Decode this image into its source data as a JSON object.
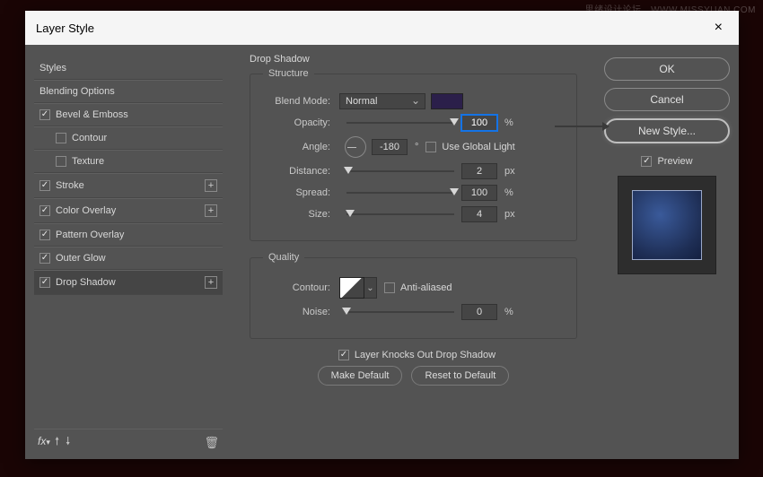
{
  "dialog": {
    "title": "Layer Style"
  },
  "watermark": "思绪设计论坛　WWW.MISSYUAN.COM",
  "sidebar": {
    "items": [
      {
        "label": "Styles",
        "checked": null,
        "plus": false,
        "sub": false
      },
      {
        "label": "Blending Options",
        "checked": null,
        "plus": false,
        "sub": false
      },
      {
        "label": "Bevel & Emboss",
        "checked": true,
        "plus": false,
        "sub": false
      },
      {
        "label": "Contour",
        "checked": false,
        "plus": false,
        "sub": true
      },
      {
        "label": "Texture",
        "checked": false,
        "plus": false,
        "sub": true
      },
      {
        "label": "Stroke",
        "checked": true,
        "plus": true,
        "sub": false
      },
      {
        "label": "Color Overlay",
        "checked": true,
        "plus": true,
        "sub": false
      },
      {
        "label": "Pattern Overlay",
        "checked": true,
        "plus": false,
        "sub": false
      },
      {
        "label": "Outer Glow",
        "checked": true,
        "plus": false,
        "sub": false
      },
      {
        "label": "Drop Shadow",
        "checked": true,
        "plus": true,
        "sub": false,
        "selected": true
      }
    ],
    "fx": "fx"
  },
  "panel": {
    "title": "Drop Shadow",
    "structure": {
      "legend": "Structure",
      "blend_mode_label": "Blend Mode:",
      "blend_mode_value": "Normal",
      "opacity_label": "Opacity:",
      "opacity_value": "100",
      "opacity_unit": "%",
      "angle_label": "Angle:",
      "angle_value": "-180",
      "angle_unit": "°",
      "global_light_label": "Use Global Light",
      "global_light_checked": false,
      "distance_label": "Distance:",
      "distance_value": "2",
      "distance_unit": "px",
      "spread_label": "Spread:",
      "spread_value": "100",
      "spread_unit": "%",
      "size_label": "Size:",
      "size_value": "4",
      "size_unit": "px"
    },
    "quality": {
      "legend": "Quality",
      "contour_label": "Contour:",
      "antialiased_label": "Anti-aliased",
      "antialiased_checked": false,
      "noise_label": "Noise:",
      "noise_value": "0",
      "noise_unit": "%"
    },
    "knockout_label": "Layer Knocks Out Drop Shadow",
    "knockout_checked": true,
    "make_default": "Make Default",
    "reset_default": "Reset to Default"
  },
  "right": {
    "ok": "OK",
    "cancel": "Cancel",
    "new_style": "New Style...",
    "preview_label": "Preview",
    "preview_checked": true
  }
}
